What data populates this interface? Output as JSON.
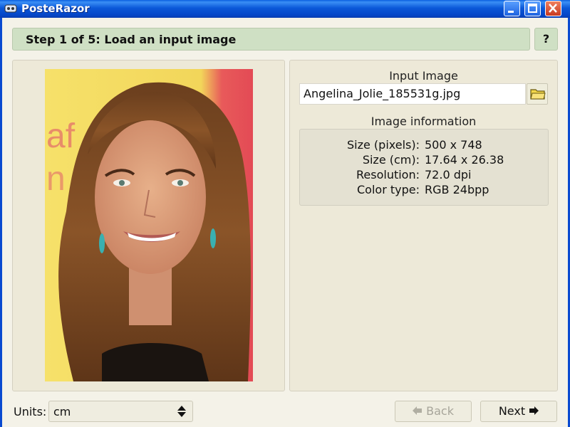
{
  "window": {
    "title": "PosteRazor"
  },
  "step": {
    "title": "Step 1 of 5: Load an input image",
    "help_label": "?"
  },
  "input_image": {
    "label": "Input Image",
    "filename": "Angelina_Jolie_185531g.jpg"
  },
  "image_information": {
    "label": "Image information",
    "rows": [
      {
        "key": "Size (pixels):",
        "value": "500 x 748"
      },
      {
        "key": "Size (cm):",
        "value": "17.64 x 26.38"
      },
      {
        "key": "Resolution:",
        "value": "72.0 dpi"
      },
      {
        "key": "Color type:",
        "value": "RGB 24bpp"
      }
    ]
  },
  "footer": {
    "units_label": "Units:",
    "units_value": "cm",
    "back_label": "Back",
    "next_label": "Next"
  },
  "colors": {
    "titlebar": "#0b58d8",
    "header_green": "#cfe0c4",
    "panel": "#ede9d8"
  },
  "icons": [
    "app-icon",
    "minimize-icon",
    "maximize-icon",
    "close-icon",
    "folder-open-icon",
    "up-down-arrow-icon",
    "back-arrow-icon",
    "next-arrow-icon"
  ]
}
